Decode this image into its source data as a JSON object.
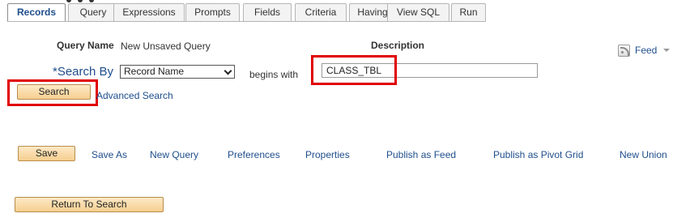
{
  "tabs": [
    {
      "label": "Records",
      "active": true
    },
    {
      "label": "Query"
    },
    {
      "label": "Expressions"
    },
    {
      "label": "Prompts"
    },
    {
      "label": "Fields"
    },
    {
      "label": "Criteria"
    },
    {
      "label": "Having"
    },
    {
      "label": "View SQL"
    },
    {
      "label": "Run"
    }
  ],
  "query_name": {
    "label": "Query Name",
    "value": "New Unsaved Query"
  },
  "description": {
    "label": "Description"
  },
  "feed": {
    "label": "Feed"
  },
  "search": {
    "by_label": "*Search By",
    "by_value": "Record Name",
    "operator": "begins with",
    "input_value": "CLASS_TBL",
    "search_button": "Search",
    "advanced_link": "Advanced Search"
  },
  "actions": {
    "save": "Save",
    "save_as": "Save As",
    "new_query": "New Query",
    "preferences": "Preferences",
    "properties": "Properties",
    "publish_feed": "Publish as Feed",
    "publish_pivot": "Publish as Pivot Grid",
    "new_union": "New Union"
  },
  "return_button": "Return To Search",
  "colors": {
    "highlight": "#e00000",
    "link": "#1f4e8c",
    "button": "#f6cf90"
  }
}
